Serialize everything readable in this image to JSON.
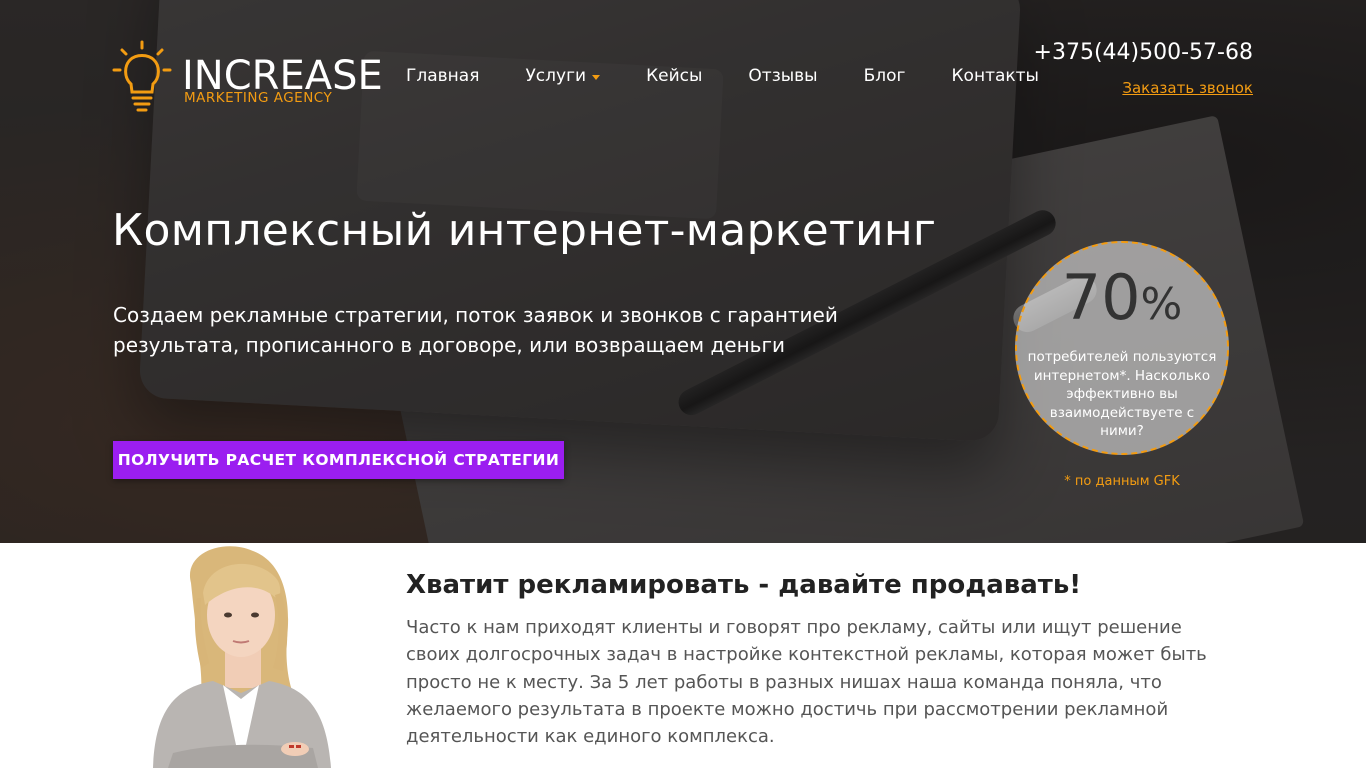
{
  "logo": {
    "word": "INCREASE",
    "sub": "MARKETING AGENCY",
    "icon": "lightbulb-icon"
  },
  "nav": {
    "items": [
      {
        "label": "Главная"
      },
      {
        "label": "Услуги",
        "has_dropdown": true
      },
      {
        "label": "Кейсы"
      },
      {
        "label": "Отзывы"
      },
      {
        "label": "Блог"
      },
      {
        "label": "Контакты"
      }
    ]
  },
  "contact": {
    "phone": "+375(44)500-57-68",
    "callback": "Заказать звонок"
  },
  "hero": {
    "title": "Комплексный интернет-маркетинг",
    "subtitle": "Создаем рекламные стратегии, поток заявок и звонков с гарантией результата, прописанного в договоре, или возвращаем деньги",
    "cta": "ПОЛУЧИТЬ РАСЧЕТ КОМПЛЕКСНОЙ СТРАТЕГИИ"
  },
  "stat": {
    "value": "70",
    "unit": "%",
    "text": "потребителей пользуются интернетом*. Насколько эффективно вы взаимодействуете с ними?",
    "note": "* по данным GFK"
  },
  "about": {
    "title": "Хватит рекламировать - давайте продавать!",
    "text": "Часто к нам приходят клиенты и говорят про рекламу, сайты или ищут решение своих долгосрочных задач в настройке контекстной рекламы, которая может быть просто не к месту. За 5 лет работы в разных нишах наша команда поняла, что желаемого результата в проекте можно достичь при рассмотрении рекламной деятельности как единого комплекса."
  },
  "colors": {
    "accent": "#f39c12",
    "cta": "#9b1ef0"
  }
}
